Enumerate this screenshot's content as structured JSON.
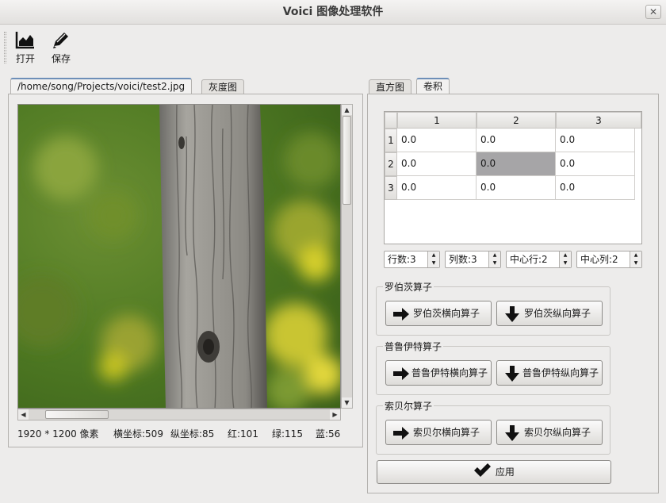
{
  "window": {
    "title": "Voici 图像处理软件",
    "close_glyph": "✕"
  },
  "toolbar": {
    "open_label": "打开",
    "save_label": "保存"
  },
  "left_tabs": [
    {
      "label": "/home/song/Projects/voici/test2.jpg",
      "active": true
    },
    {
      "label": "灰度图",
      "active": false
    }
  ],
  "status": {
    "size": "1920 * 1200 像素",
    "x": "横坐标:509",
    "y": "纵坐标:85",
    "red": "红:101",
    "green": "绿:115",
    "blue": "蓝:56"
  },
  "right_tabs": [
    {
      "label": "直方图",
      "active": false
    },
    {
      "label": "卷积",
      "active": true
    }
  ],
  "kernel": {
    "col_headers": [
      "1",
      "2",
      "3"
    ],
    "row_headers": [
      "1",
      "2",
      "3"
    ],
    "cells": [
      [
        "0.0",
        "0.0",
        "0.0"
      ],
      [
        "0.0",
        "0.0",
        "0.0"
      ],
      [
        "0.0",
        "0.0",
        "0.0"
      ]
    ],
    "selected_cell": "row 2, col 2"
  },
  "spinners": {
    "rows": "行数:3",
    "cols": "列数:3",
    "center_row": "中心行:2",
    "center_col": "中心列:2"
  },
  "operators": [
    {
      "title": "罗伯茨算子",
      "horizontal": "罗伯茨横向算子",
      "vertical": "罗伯茨纵向算子"
    },
    {
      "title": "普鲁伊特算子",
      "horizontal": "普鲁伊特横向算子",
      "vertical": "普鲁伊特纵向算子"
    },
    {
      "title": "索贝尔算子",
      "horizontal": "索贝尔横向算子",
      "vertical": "索贝尔纵向算子"
    }
  ],
  "apply_label": "应用",
  "icons": {
    "open": "area-chart-icon",
    "save": "pen-icon",
    "horizontal": "arrow-right-icon",
    "vertical": "arrow-down-icon",
    "apply": "checkmark-icon"
  },
  "colors": {
    "selected_cell": "#a6a5a7",
    "tab_accent": "#6e8fb8"
  }
}
